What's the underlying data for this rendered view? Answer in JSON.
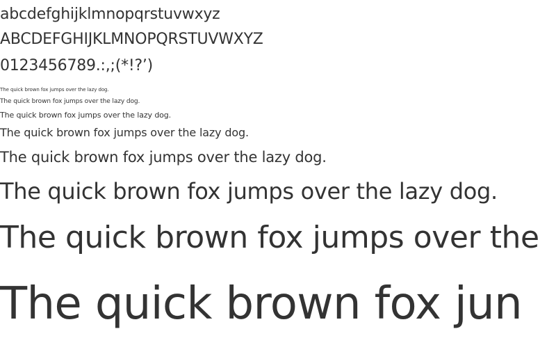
{
  "specimen": {
    "lowercase": "abcdefghijklmnopqrstuvwxyz",
    "uppercase": "ABCDEFGHIJKLMNOPQRSTUVWXYZ",
    "digits_punctuation": "0123456789.:,;(*!?’)",
    "pangram_1": "The quick brown fox jumps over the lazy dog.",
    "pangram_2": "The quick brown fox jumps over the lazy dog.",
    "pangram_3": "The quick brown fox jumps over the lazy dog.",
    "pangram_4": "The quick brown fox jumps over the lazy dog.",
    "pangram_5": "The quick brown fox jumps over the lazy dog.",
    "pangram_6": "The quick brown fox jumps over the lazy dog.",
    "pangram_7": "The quick brown fox jumps over the",
    "pangram_8": "The quick brown fox jun"
  },
  "colors": {
    "text": "#333333",
    "background": "#ffffff"
  }
}
